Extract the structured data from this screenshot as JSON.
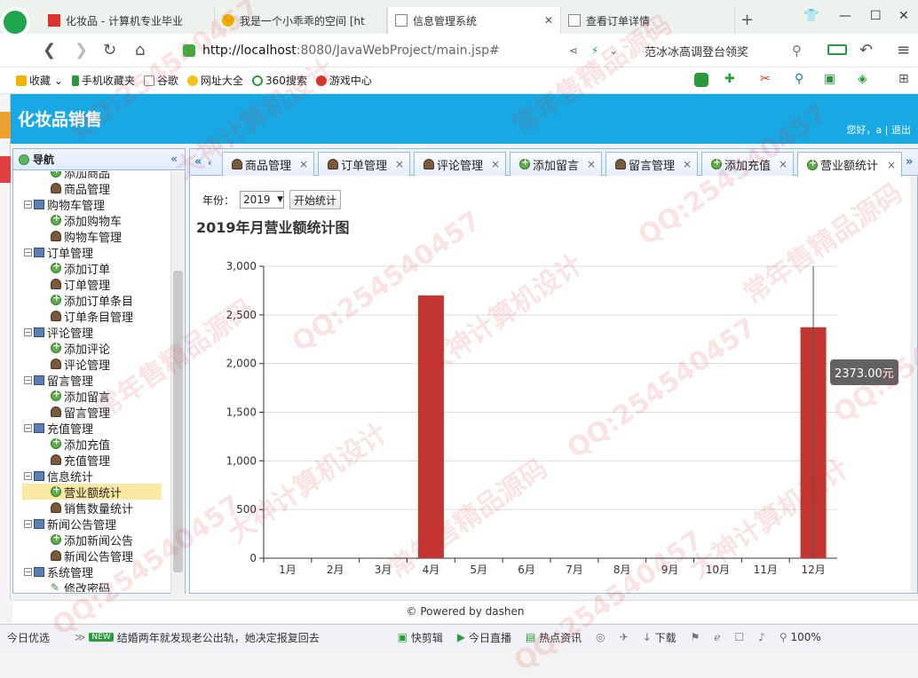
{
  "browser": {
    "tabs": [
      {
        "label": "化妆品 - 计算机专业毕业",
        "active": false
      },
      {
        "label": "我是一个小乖乖的空间 [ht",
        "active": false
      },
      {
        "label": "信息管理系统",
        "active": true
      },
      {
        "label": "查看订单详情",
        "active": false
      }
    ],
    "new_tab": "+",
    "url_host": "http://localhost",
    "url_rest": ":8080/JavaWebProject/main.jsp#",
    "search_hint": "范冰冰高调登台领奖",
    "bookmarks": [
      "收藏",
      "手机收藏夹",
      "谷歌",
      "网址大全",
      "360搜索",
      "游戏中心"
    ]
  },
  "app": {
    "title": "化妆品销售",
    "welcome": "您好，a | 退出"
  },
  "nav": {
    "title": "导航",
    "collapse": "«",
    "items": [
      {
        "label": "添加商品",
        "type": "plus",
        "level": 2,
        "partial": true
      },
      {
        "label": "商品管理",
        "type": "user",
        "level": 2
      },
      {
        "label": "购物车管理",
        "type": "folder",
        "level": 1
      },
      {
        "label": "添加购物车",
        "type": "plus",
        "level": 2
      },
      {
        "label": "购物车管理",
        "type": "user",
        "level": 2
      },
      {
        "label": "订单管理",
        "type": "folder",
        "level": 1
      },
      {
        "label": "添加订单",
        "type": "plus",
        "level": 2
      },
      {
        "label": "订单管理",
        "type": "user",
        "level": 2
      },
      {
        "label": "添加订单条目",
        "type": "plus",
        "level": 2
      },
      {
        "label": "订单条目管理",
        "type": "user",
        "level": 2
      },
      {
        "label": "评论管理",
        "type": "folder",
        "level": 1
      },
      {
        "label": "添加评论",
        "type": "plus",
        "level": 2
      },
      {
        "label": "评论管理",
        "type": "user",
        "level": 2
      },
      {
        "label": "留言管理",
        "type": "folder",
        "level": 1
      },
      {
        "label": "添加留言",
        "type": "plus",
        "level": 2
      },
      {
        "label": "留言管理",
        "type": "user",
        "level": 2
      },
      {
        "label": "充值管理",
        "type": "folder",
        "level": 1
      },
      {
        "label": "添加充值",
        "type": "plus",
        "level": 2
      },
      {
        "label": "充值管理",
        "type": "user",
        "level": 2
      },
      {
        "label": "信息统计",
        "type": "folder",
        "level": 1
      },
      {
        "label": "营业额统计",
        "type": "plus",
        "level": 2,
        "selected": true
      },
      {
        "label": "销售数量统计",
        "type": "user",
        "level": 2
      },
      {
        "label": "新闻公告管理",
        "type": "folder",
        "level": 1
      },
      {
        "label": "添加新闻公告",
        "type": "plus",
        "level": 2
      },
      {
        "label": "新闻公告管理",
        "type": "user",
        "level": 2
      },
      {
        "label": "系统管理",
        "type": "folder",
        "level": 1
      },
      {
        "label": "修改密码",
        "type": "pen",
        "level": 2
      }
    ]
  },
  "tabs": [
    {
      "label": "商品管理",
      "icon": "user"
    },
    {
      "label": "订单管理",
      "icon": "user"
    },
    {
      "label": "评论管理",
      "icon": "user"
    },
    {
      "label": "添加留言",
      "icon": "plus"
    },
    {
      "label": "留言管理",
      "icon": "user"
    },
    {
      "label": "添加充值",
      "icon": "plus"
    },
    {
      "label": "营业额统计",
      "icon": "plus",
      "active": true
    }
  ],
  "filter": {
    "year_label": "年份：",
    "year_value": "2019",
    "button": "开始统计"
  },
  "chart_title": "2019年月营业额统计图",
  "chart_data": {
    "type": "bar",
    "title": "2019年月营业额统计图",
    "categories": [
      "1月",
      "2月",
      "3月",
      "4月",
      "5月",
      "6月",
      "7月",
      "8月",
      "9月",
      "10月",
      "11月",
      "12月"
    ],
    "values": [
      0,
      0,
      0,
      2700,
      0,
      0,
      0,
      0,
      0,
      0,
      0,
      2373
    ],
    "ylim": [
      0,
      3000
    ],
    "yticks": [
      "0",
      "500",
      "1,000",
      "1,500",
      "2,000",
      "2,500",
      "3,000"
    ],
    "grid": true,
    "color": "#c23531",
    "tooltip": "2373.00元"
  },
  "footer": "© Powered by dashen",
  "statusbar": {
    "left": "今日优选",
    "news": "结婚两年就发现老公出轨，她决定报复回去",
    "news_badge": "NEW",
    "items": [
      "快剪辑",
      "今日直播",
      "热点资讯",
      "下载",
      "100%"
    ]
  },
  "watermark": [
    "QQ:254540457",
    "大神计算机设计",
    "常年售精品源码"
  ]
}
